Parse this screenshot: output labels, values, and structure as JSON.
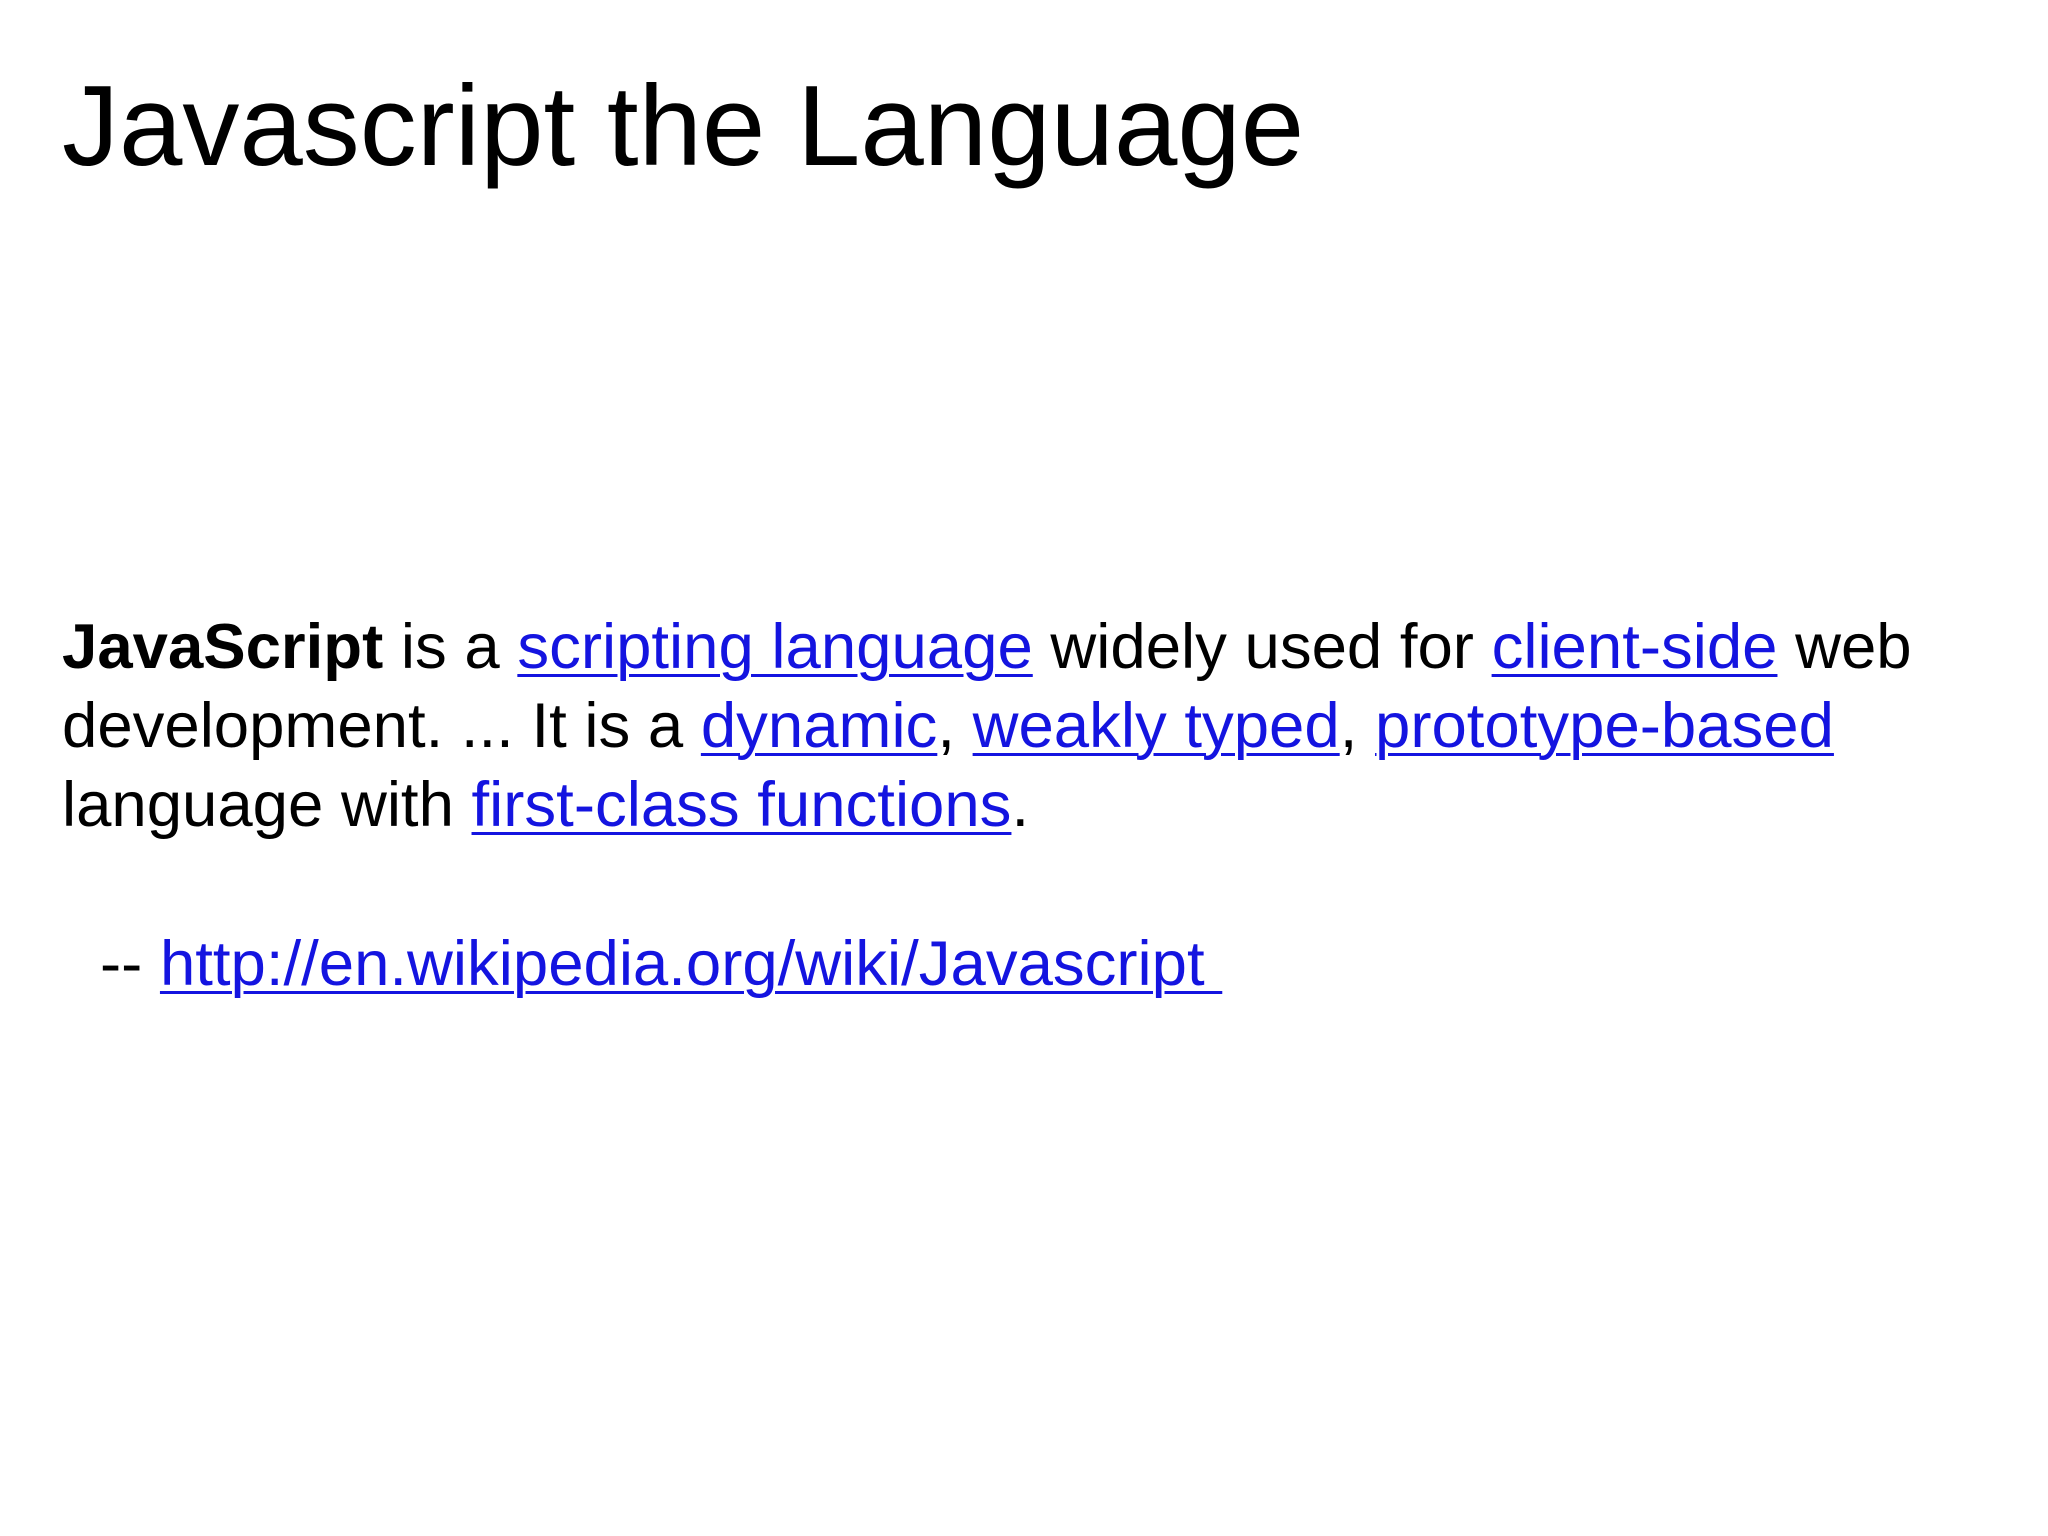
{
  "slide": {
    "title": "Javascript the Language",
    "paragraph": {
      "term": "JavaScript",
      "t1": " is a ",
      "link_scripting_language": "scripting language",
      "t2": " widely used for ",
      "link_client_side": "client-side",
      "t3": " web development. ... It is a ",
      "link_dynamic": "dynamic",
      "t4": ", ",
      "link_weakly_typed": "weakly typed",
      "t5": ", ",
      "link_prototype_based": "prototype-based",
      "t6": " language with ",
      "link_first_class_functions": "first-class functions",
      "t7": "."
    },
    "citation": {
      "prefix": "-- ",
      "link_text": "http://en.wikipedia.org/wiki/Javascript "
    }
  },
  "colors": {
    "link": "#1414e0",
    "text": "#000000",
    "background": "#ffffff"
  }
}
